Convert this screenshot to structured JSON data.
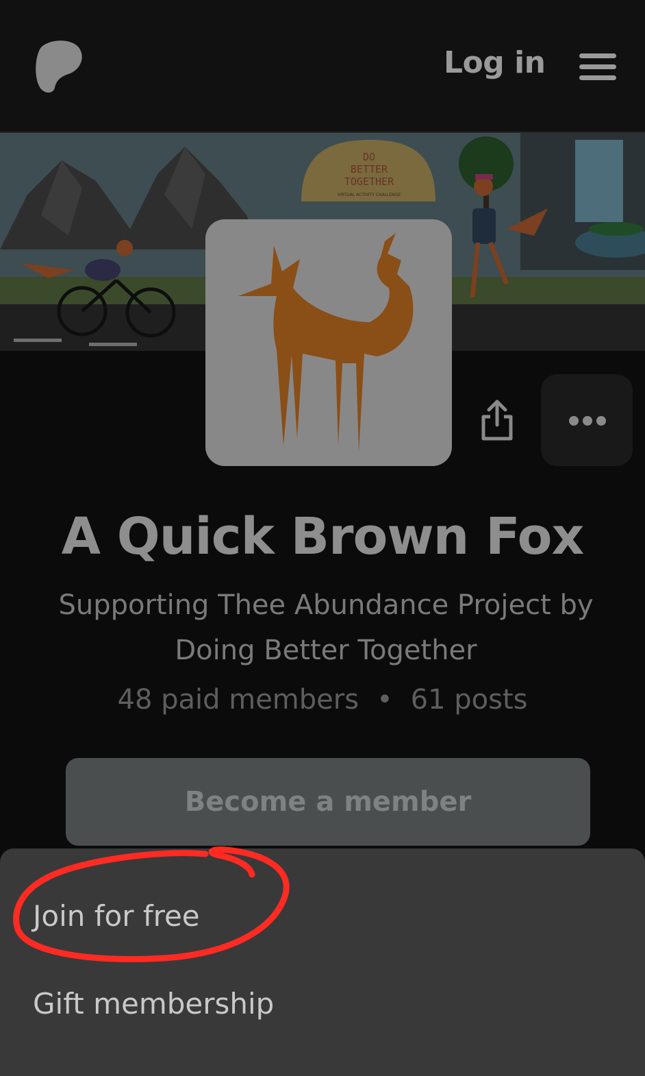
{
  "header": {
    "login_label": "Log in"
  },
  "banner": {
    "sign_line1": "DO",
    "sign_line2": "BETTER",
    "sign_line3": "TOGETHER",
    "sign_caption": "VIRTUAL ACTIVITY CHALLENGE"
  },
  "creator": {
    "name": "A Quick Brown Fox",
    "tagline": "Supporting Thee Abundance Project by Doing Better Together",
    "paid_members": "48 paid members",
    "separator": "•",
    "posts": "61 posts"
  },
  "actions": {
    "become_member_label": "Become a member"
  },
  "sheet": {
    "join_label": "Join for free",
    "gift_label": "Gift membership"
  },
  "colors": {
    "background": "#0b0b0b",
    "sheet": "#393939",
    "fox": "#8a4e17",
    "annotation": "#ff2a22"
  },
  "icons": [
    "patreon-logo-icon",
    "menu-icon",
    "share-icon",
    "more-dots-icon"
  ]
}
